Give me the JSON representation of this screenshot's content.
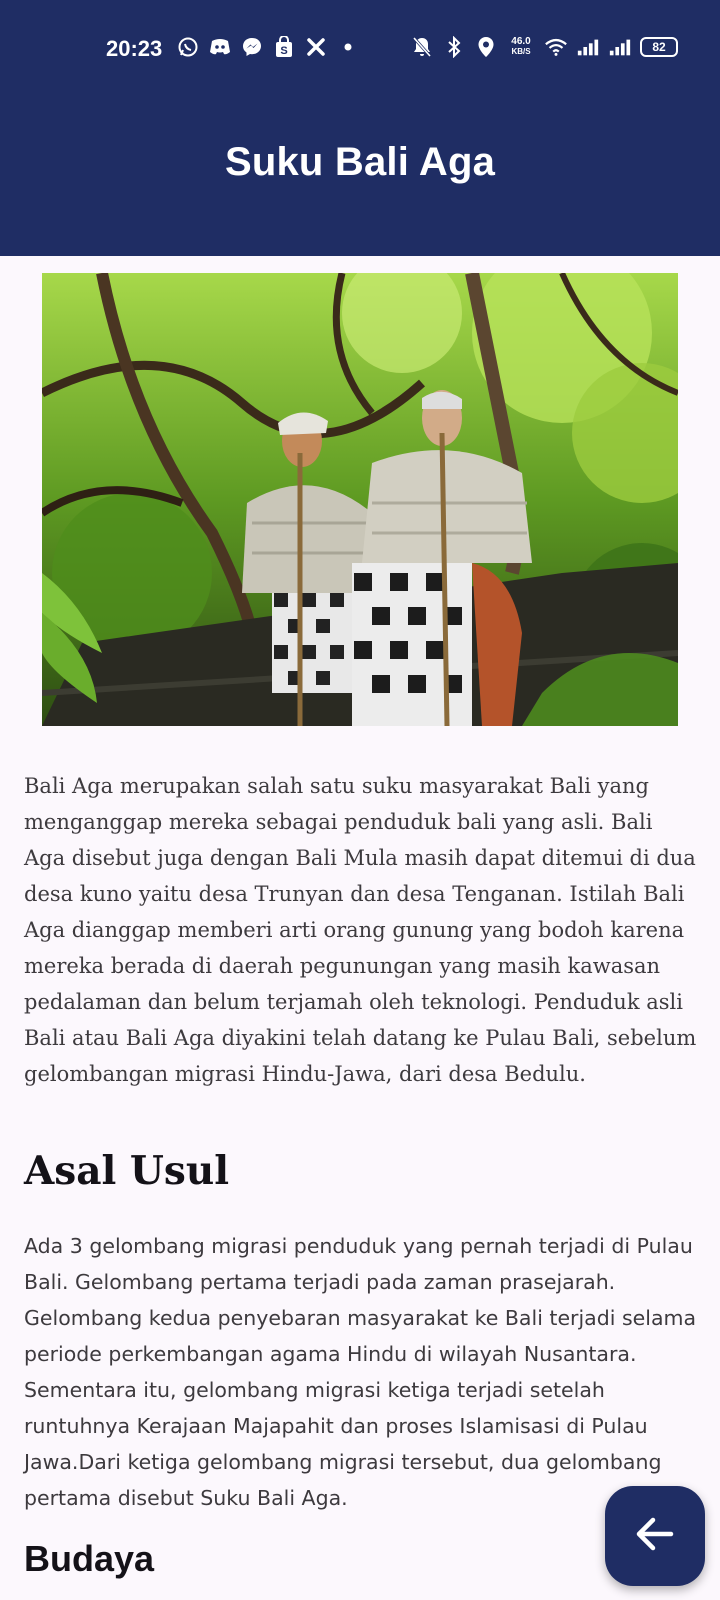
{
  "status_bar": {
    "time": "20:23",
    "network_speed_value": "46.0",
    "network_speed_unit": "KB/S",
    "battery": "82",
    "left_icons": [
      "whatsapp-icon",
      "discord-icon",
      "messenger-icon",
      "shopping-bag-icon",
      "x-icon",
      "dot-icon"
    ],
    "right_icons": [
      "mute-icon",
      "bluetooth-icon",
      "location-icon",
      "wifi-icon",
      "signal-icon",
      "signal-icon"
    ]
  },
  "app_bar": {
    "title": "Suku Bali Aga"
  },
  "hero_image": {
    "alt": ""
  },
  "intro_text": "Bali Aga merupakan salah satu suku masyarakat Bali yang menganggap mereka sebagai penduduk bali yang asli. Bali Aga disebut juga dengan Bali Mula masih dapat ditemui di dua desa kuno yaitu desa Trunyan dan desa Tenganan. Istilah Bali Aga dianggap memberi arti orang gunung yang bodoh karena mereka berada di daerah pegunungan yang masih kawasan pedalaman dan belum terjamah oleh teknologi. Penduduk asli Bali atau Bali Aga diyakini telah datang ke Pulau Bali, sebelum gelombangan migrasi Hindu-Jawa, dari desa Bedulu.",
  "section_asal_usul": {
    "heading": "Asal Usul",
    "text": "Ada 3 gelombang migrasi penduduk yang pernah terjadi di Pulau Bali. Gelombang pertama terjadi pada zaman prasejarah. Gelombang kedua penyebaran masyarakat ke Bali terjadi selama periode perkembangan agama Hindu di wilayah Nusantara. Sementara itu, gelombang migrasi ketiga terjadi setelah runtuhnya Kerajaan Majapahit dan proses Islamisasi di Pulau Jawa.Dari ketiga gelombang migrasi tersebut, dua gelombang pertama disebut Suku Bali Aga."
  },
  "section_budaya": {
    "heading": "Budaya"
  },
  "fab": {
    "icon": "arrow-left-icon"
  },
  "colors": {
    "primary": "#1f2d64",
    "background": "#fcf8fd",
    "text": "#3d3a3e"
  }
}
